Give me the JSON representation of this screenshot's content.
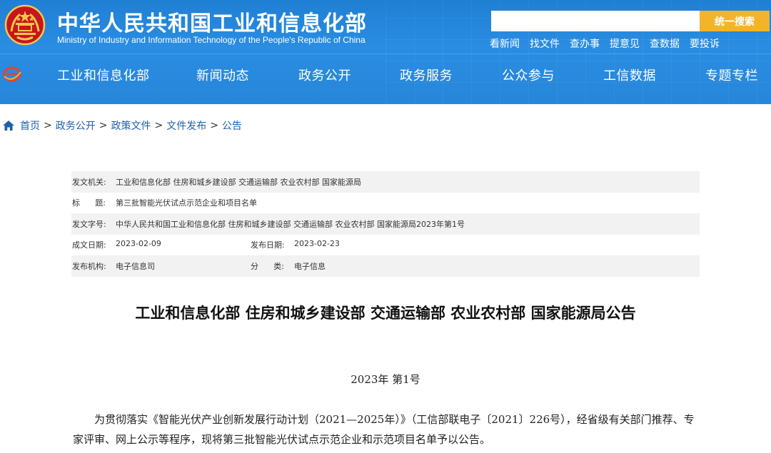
{
  "header": {
    "site_title": "中华人民共和国工业和信息化部",
    "site_subtitle": "Ministry of Industry and Information Technology of the People's Republic of China",
    "search": {
      "placeholder": "",
      "value": "",
      "button_label": "统一搜索"
    },
    "quick_links": [
      "看新闻",
      "找文件",
      "查办事",
      "提意见",
      "查数据",
      "要投诉"
    ],
    "emblem_icon": "national-emblem-icon",
    "colors": {
      "header_blue": "#2a8de2",
      "search_button": "#f5b32a"
    }
  },
  "nav": {
    "items": [
      "工业和信息化部",
      "新闻动态",
      "政务公开",
      "政务服务",
      "公众参与",
      "工信数据",
      "专题专栏"
    ]
  },
  "breadcrumb": {
    "items": [
      "首页",
      "政务公开",
      "政策文件",
      "文件发布",
      "公告"
    ],
    "separator": ">"
  },
  "info": {
    "issuer_label": "发文机关:",
    "issuer": "工业和信息化部 住房和城乡建设部 交通运输部 农业农村部 国家能源局",
    "title_label_a": "标",
    "title_label_b": "题:",
    "title": "第三批智能光伏试点示范企业和项目名单",
    "doc_no_label": "发文字号:",
    "doc_no": "中华人民共和国工业和信息化部 住房和城乡建设部 交通运输部 农业农村部 国家能源局2023年第1号",
    "created_label": "成文日期:",
    "created": "2023-02-09",
    "published_label": "发布日期:",
    "published": "2023-02-23",
    "agency_label": "发布机构:",
    "agency": "电子信息司",
    "category_label_a": "分",
    "category_label_b": "类:",
    "category": "电子信息"
  },
  "document": {
    "title": "工业和信息化部 住房和城乡建设部 交通运输部 农业农村部 国家能源局公告",
    "number": "2023年  第1号",
    "paragraph": "为贯彻落实《智能光伏产业创新发展行动计划（2021—2025年）》（工信部联电子〔2021〕226号），经省级有关部门推荐、专家评审、网上公示等程序，现将第三批智能光伏试点示范企业和示范项目名单予以公告。"
  }
}
